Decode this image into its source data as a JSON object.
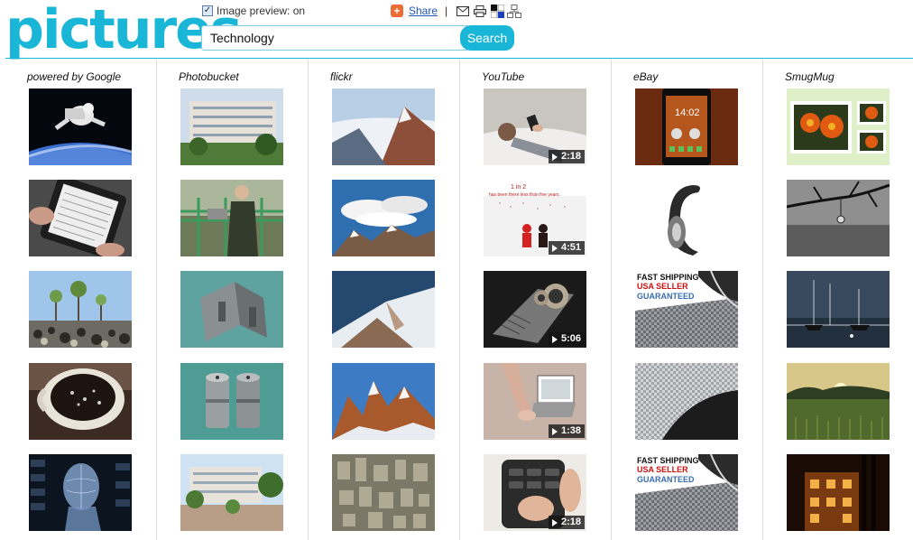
{
  "app": {
    "logo": "pictures"
  },
  "header": {
    "image_preview_label": "Image preview: on",
    "image_preview_checked": true,
    "share_label": "Share",
    "separator": "|",
    "tools": [
      "mail-icon",
      "print-icon",
      "colors-icon",
      "sitemap-icon"
    ]
  },
  "search": {
    "value": "Technology",
    "button_label": "Search"
  },
  "columns": [
    {
      "title": "powered by Google",
      "thumbs": [
        {
          "icon": "astronaut-image"
        },
        {
          "icon": "tablet-image"
        },
        {
          "icon": "pebbles-trees-image"
        },
        {
          "icon": "coffee-cup-image"
        },
        {
          "icon": "digital-face-image"
        }
      ]
    },
    {
      "title": "Photobucket",
      "thumbs": [
        {
          "icon": "building-image"
        },
        {
          "icon": "man-machine-image"
        },
        {
          "icon": "metal-part-image"
        },
        {
          "icon": "metal-cylinders-image"
        },
        {
          "icon": "campus-image"
        }
      ]
    },
    {
      "title": "flickr",
      "thumbs": [
        {
          "icon": "mountain-image"
        },
        {
          "icon": "clouds-peaks-image"
        },
        {
          "icon": "snowy-ridge-image"
        },
        {
          "icon": "alpine-peaks-image"
        },
        {
          "icon": "city-aerial-image"
        }
      ]
    },
    {
      "title": "YouTube",
      "thumbs": [
        {
          "icon": "video-bed-image",
          "duration": "2:18"
        },
        {
          "icon": "video-figures-image",
          "duration": "4:51"
        },
        {
          "icon": "video-mechanism-image",
          "duration": "5:06"
        },
        {
          "icon": "video-finger-image",
          "duration": "1:38"
        },
        {
          "icon": "video-phone-keys-image",
          "duration": "2:18"
        }
      ]
    },
    {
      "title": "eBay",
      "thumbs": [
        {
          "icon": "smartphone-image"
        },
        {
          "icon": "headset-image"
        },
        {
          "icon": "carbon-ad-image",
          "ad": [
            "FAST SHIPPING",
            "USA SELLER",
            "GUARANTEED"
          ]
        },
        {
          "icon": "carbon-fiber-image"
        },
        {
          "icon": "carbon-ad-image",
          "ad": [
            "FAST SHIPPING",
            "USA SELLER",
            "GUARANTEED"
          ]
        }
      ]
    },
    {
      "title": "SmugMug",
      "thumbs": [
        {
          "icon": "flowers-image"
        },
        {
          "icon": "branch-drop-image"
        },
        {
          "icon": "harbor-image"
        },
        {
          "icon": "sunset-field-image"
        },
        {
          "icon": "night-building-image"
        }
      ]
    }
  ]
}
